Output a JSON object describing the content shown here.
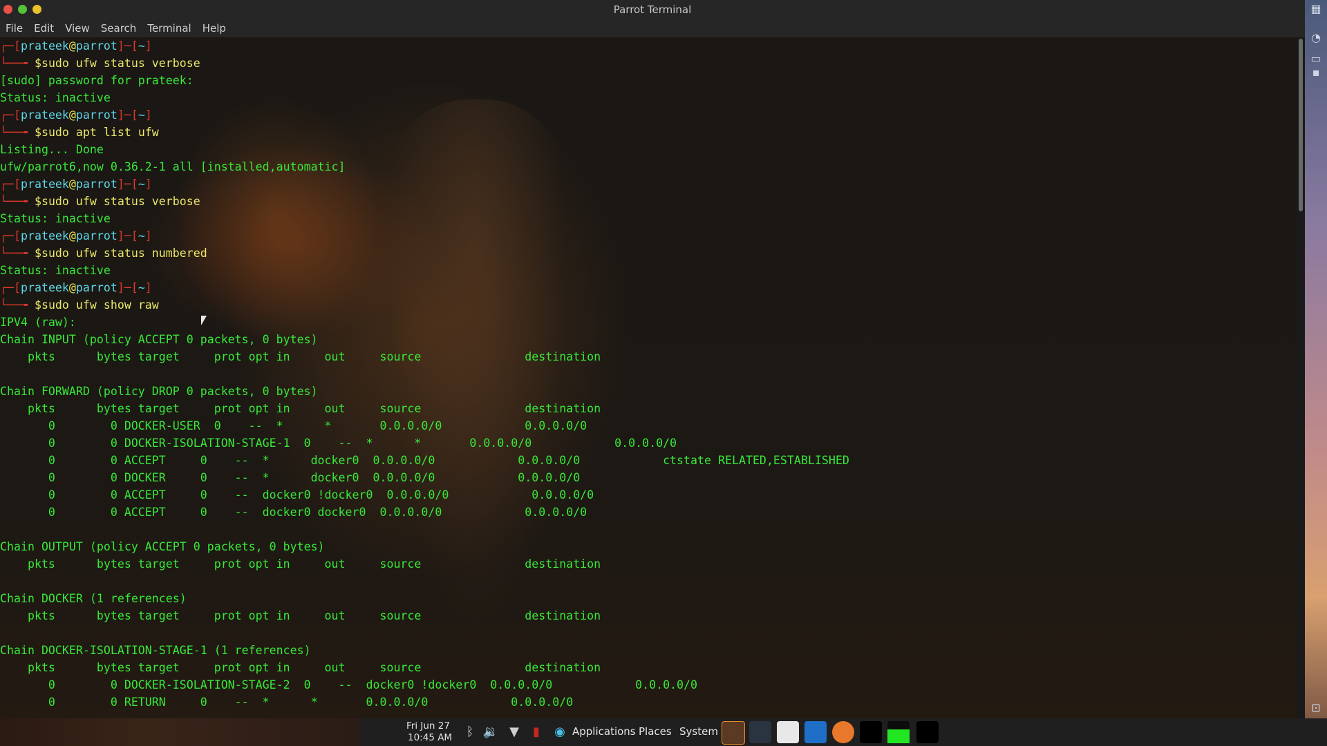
{
  "window": {
    "title": "Parrot Terminal",
    "menu": [
      "File",
      "Edit",
      "View",
      "Search",
      "Terminal",
      "Help"
    ]
  },
  "prompt": {
    "user": "prateek",
    "host": "parrot",
    "path": "~"
  },
  "terminal_lines": [
    {
      "kind": "prompt"
    },
    {
      "kind": "cmd",
      "text": "sudo ufw status verbose"
    },
    {
      "kind": "out",
      "text": "[sudo] password for prateek:"
    },
    {
      "kind": "out",
      "text": "Status: inactive"
    },
    {
      "kind": "prompt"
    },
    {
      "kind": "cmd",
      "text": "sudo apt list ufw"
    },
    {
      "kind": "out",
      "text": "Listing... Done"
    },
    {
      "kind": "out",
      "text": "ufw/parrot6,now 0.36.2-1 all [installed,automatic]"
    },
    {
      "kind": "prompt"
    },
    {
      "kind": "cmd",
      "text": "sudo ufw status verbose"
    },
    {
      "kind": "out",
      "text": "Status: inactive"
    },
    {
      "kind": "prompt"
    },
    {
      "kind": "cmd",
      "text": "sudo ufw status numbered"
    },
    {
      "kind": "out",
      "text": "Status: inactive"
    },
    {
      "kind": "prompt"
    },
    {
      "kind": "cmd",
      "text": "sudo ufw show raw"
    },
    {
      "kind": "out",
      "text": "IPV4 (raw):"
    },
    {
      "kind": "out",
      "text": "Chain INPUT (policy ACCEPT 0 packets, 0 bytes)"
    },
    {
      "kind": "out",
      "text": "    pkts      bytes target     prot opt in     out     source               destination"
    },
    {
      "kind": "out",
      "text": ""
    },
    {
      "kind": "out",
      "text": "Chain FORWARD (policy DROP 0 packets, 0 bytes)"
    },
    {
      "kind": "out",
      "text": "    pkts      bytes target     prot opt in     out     source               destination"
    },
    {
      "kind": "out",
      "text": "       0        0 DOCKER-USER  0    --  *      *       0.0.0.0/0            0.0.0.0/0"
    },
    {
      "kind": "out",
      "text": "       0        0 DOCKER-ISOLATION-STAGE-1  0    --  *      *       0.0.0.0/0            0.0.0.0/0"
    },
    {
      "kind": "out",
      "text": "       0        0 ACCEPT     0    --  *      docker0  0.0.0.0/0            0.0.0.0/0            ctstate RELATED,ESTABLISHED"
    },
    {
      "kind": "out",
      "text": "       0        0 DOCKER     0    --  *      docker0  0.0.0.0/0            0.0.0.0/0"
    },
    {
      "kind": "out",
      "text": "       0        0 ACCEPT     0    --  docker0 !docker0  0.0.0.0/0            0.0.0.0/0"
    },
    {
      "kind": "out",
      "text": "       0        0 ACCEPT     0    --  docker0 docker0  0.0.0.0/0            0.0.0.0/0"
    },
    {
      "kind": "out",
      "text": ""
    },
    {
      "kind": "out",
      "text": "Chain OUTPUT (policy ACCEPT 0 packets, 0 bytes)"
    },
    {
      "kind": "out",
      "text": "    pkts      bytes target     prot opt in     out     source               destination"
    },
    {
      "kind": "out",
      "text": ""
    },
    {
      "kind": "out",
      "text": "Chain DOCKER (1 references)"
    },
    {
      "kind": "out",
      "text": "    pkts      bytes target     prot opt in     out     source               destination"
    },
    {
      "kind": "out",
      "text": ""
    },
    {
      "kind": "out",
      "text": "Chain DOCKER-ISOLATION-STAGE-1 (1 references)"
    },
    {
      "kind": "out",
      "text": "    pkts      bytes target     prot opt in     out     source               destination"
    },
    {
      "kind": "out",
      "text": "       0        0 DOCKER-ISOLATION-STAGE-2  0    --  docker0 !docker0  0.0.0.0/0            0.0.0.0/0"
    },
    {
      "kind": "out",
      "text": "       0        0 RETURN     0    --  *      *       0.0.0.0/0            0.0.0.0/0"
    }
  ],
  "taskbar": {
    "date": "Fri Jun 27",
    "time": "10:45 AM",
    "menus": [
      "Applications",
      "Places",
      "System"
    ],
    "status_icons": [
      "bluetooth-icon",
      "volume-icon",
      "wifi-icon",
      "battery-icon"
    ]
  },
  "colors": {
    "output_green": "#38e838",
    "prompt_red": "#e0392b",
    "prompt_cyan": "#5ed7e8",
    "command_yellow": "#ece86a"
  }
}
